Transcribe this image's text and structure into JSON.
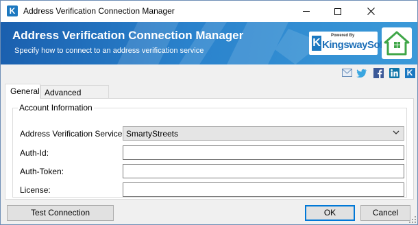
{
  "window": {
    "title": "Address Verification Connection Manager"
  },
  "banner": {
    "title": "Address Verification Connection Manager",
    "subtitle": "Specify how to connect to an address verification service",
    "powered_by": "Powered By",
    "brand": "KingswaySoft",
    "brand_color": "#1d6fb8",
    "accent": "#2a82cc"
  },
  "social_icons": [
    "email-icon",
    "twitter-icon",
    "facebook-icon",
    "linkedin-icon",
    "kingswaysoft-icon"
  ],
  "tabs": [
    {
      "label": "General",
      "selected": true
    },
    {
      "label": "Advanced Settings",
      "selected": false
    }
  ],
  "account": {
    "legend": "Account Information",
    "service_label": "Address Verification Service:",
    "service_value": "SmartyStreets",
    "auth_id_label": "Auth-Id:",
    "auth_id_value": "",
    "auth_token_label": "Auth-Token:",
    "auth_token_value": "",
    "license_label": "License:",
    "license_value": ""
  },
  "buttons": {
    "test_connection": "Test Connection",
    "ok": "OK",
    "cancel": "Cancel"
  }
}
